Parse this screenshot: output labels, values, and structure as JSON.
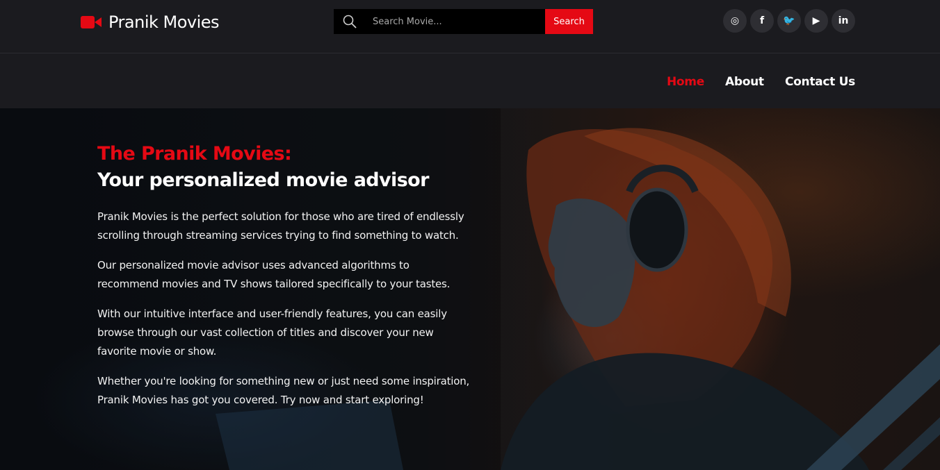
{
  "header": {
    "brand_name": "Pranik Movies",
    "accent_color": "#e50914",
    "search": {
      "placeholder": "Search Movie...",
      "button_label": "Search"
    },
    "socials": [
      {
        "name": "instagram-icon",
        "glyph": "◎"
      },
      {
        "name": "facebook-icon",
        "glyph": "f"
      },
      {
        "name": "twitter-icon",
        "glyph": "🐦"
      },
      {
        "name": "youtube-icon",
        "glyph": "▶"
      },
      {
        "name": "linkedin-icon",
        "glyph": "in"
      }
    ]
  },
  "nav": {
    "items": [
      {
        "label": "Home",
        "active": true
      },
      {
        "label": "About",
        "active": false
      },
      {
        "label": "Contact Us",
        "active": false
      }
    ]
  },
  "hero": {
    "title_accent": "The Pranik Movies:",
    "title": "Your personalized movie advisor",
    "paragraphs": [
      "Pranik Movies is the perfect solution for those who are tired of endlessly scrolling through streaming services trying to find something to watch.",
      "Our personalized movie advisor uses advanced algorithms to recommend movies and TV shows tailored specifically to your tastes.",
      "With our intuitive interface and user-friendly features, you can easily browse through our vast collection of titles and discover your new favorite movie or show.",
      "Whether you're looking for something new or just need some inspiration, Pranik Movies has got you covered. Try now and start exploring!"
    ]
  }
}
